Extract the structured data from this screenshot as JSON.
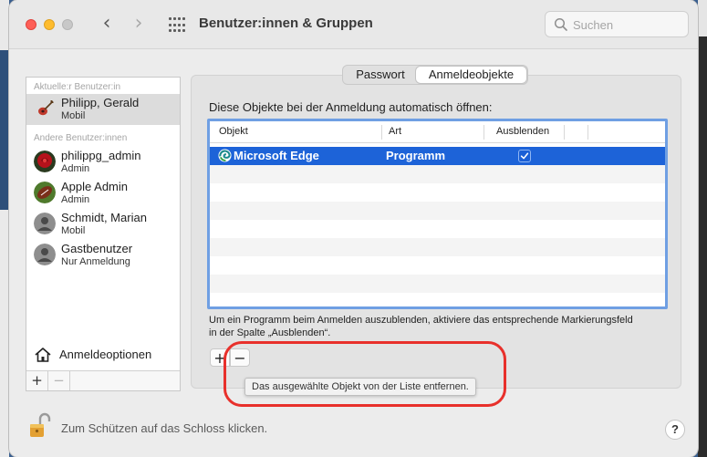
{
  "window": {
    "title": "Benutzer:innen & Gruppen",
    "search_placeholder": "Suchen"
  },
  "sidebar": {
    "current_section": "Aktuelle:r Benutzer:in",
    "other_section": "Andere Benutzer:innen",
    "current_user": {
      "name": "Philipp, Gerald",
      "role": "Mobil"
    },
    "other_users": [
      {
        "name": "philippg_admin",
        "role": "Admin"
      },
      {
        "name": "Apple Admin",
        "role": "Admin"
      },
      {
        "name": "Schmidt, Marian",
        "role": "Mobil"
      },
      {
        "name": "Gastbenutzer",
        "role": "Nur Anmeldung"
      }
    ],
    "login_options_label": "Anmeldeoptionen",
    "add_label": "+",
    "remove_label": "−"
  },
  "tabs": {
    "password": "Passwort",
    "login_items": "Anmeldeobjekte"
  },
  "main": {
    "heading": "Diese Objekte bei der Anmeldung automatisch öffnen:",
    "columns": [
      "Objekt",
      "Art",
      "Ausblenden"
    ],
    "rows": [
      {
        "object": "Microsoft Edge",
        "type": "Programm",
        "hide": true
      }
    ],
    "hint": "Um ein Programm beim Anmelden auszublenden, aktiviere das entsprechende Markierungsfeld in der Spalte „Ausblenden“.",
    "add_label": "+",
    "remove_label": "−",
    "tooltip": "Das ausgewählte Objekt von der Liste entfernen."
  },
  "footer": {
    "lock_label": "Zum Schützen auf das Schloss klicken.",
    "help_label": "?"
  },
  "colors": {
    "selection": "#1d63d8",
    "table_border": "#6f9fe3",
    "annotation": "#e8302b"
  }
}
